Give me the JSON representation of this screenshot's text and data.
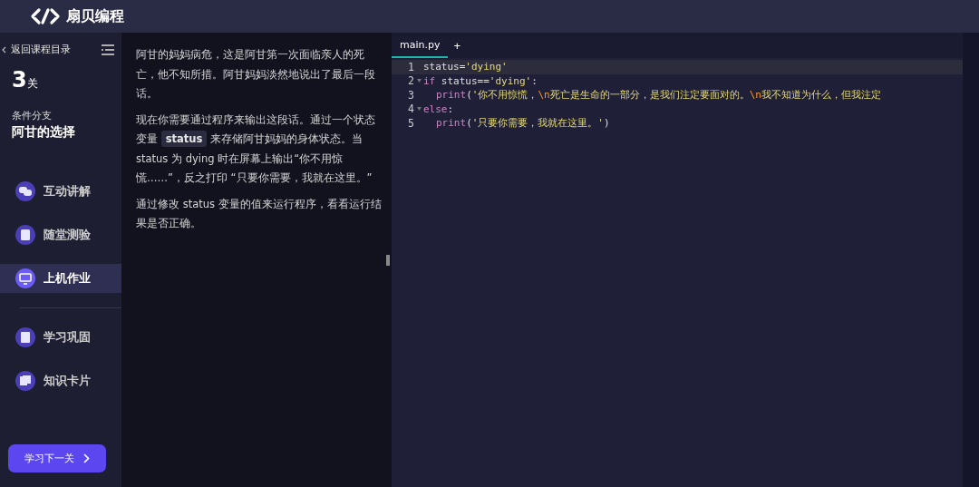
{
  "header": {
    "brand": "扇贝编程"
  },
  "sidebar": {
    "back": "返回课程目录",
    "level_number": "3",
    "level_unit": "关",
    "chapter": "条件分支",
    "lesson": "阿甘的选择",
    "items": [
      {
        "label": "互动讲解",
        "selected": false,
        "kind": "chat"
      },
      {
        "label": "随堂测验",
        "selected": false,
        "kind": "quiz"
      },
      {
        "label": "上机作业",
        "selected": true,
        "kind": "computer"
      },
      {
        "label": "学习巩固",
        "selected": false,
        "kind": "book"
      },
      {
        "label": "知识卡片",
        "selected": false,
        "kind": "cards"
      }
    ],
    "next_button": "学习下一关"
  },
  "description": [
    [
      {
        "kind": "text",
        "text": "阿甘的妈妈病危，这是阿甘第一次面临亲人的死亡，他不知所措。阿甘妈妈淡然地说出了最后一段话。"
      }
    ],
    [
      {
        "kind": "text",
        "text": "现在你需要通过程序来输出这段话。通过一个状态变量 "
      },
      {
        "kind": "code",
        "text": "status"
      },
      {
        "kind": "text",
        "text": " 来存储阿甘妈妈的身体状态。当 status 为 dying 时在屏幕上输出“你不用惊慌……”，反之打印 “只要你需要，我就在这里。”"
      }
    ],
    [
      {
        "kind": "text",
        "text": "通过修改 status 变量的值来运行程序，看看运行结果是否正确。"
      }
    ]
  ],
  "editor": {
    "tabs": [
      {
        "label": "main.py",
        "selected": true
      }
    ],
    "add_tab": "+",
    "lines": [
      {
        "number": "1",
        "active": true,
        "foldable": false,
        "tokens": [
          {
            "kind": "plain",
            "text": "status="
          },
          {
            "kind": "string",
            "text": "'dying'"
          }
        ]
      },
      {
        "number": "2",
        "active": false,
        "foldable": true,
        "tokens": [
          {
            "kind": "keyword",
            "text": "if"
          },
          {
            "kind": "plain",
            "text": " status=="
          },
          {
            "kind": "string",
            "text": "'dying'"
          },
          {
            "kind": "plain",
            "text": ":"
          }
        ],
        "children": [
          {
            "number": "3",
            "active": false,
            "foldable": false,
            "tokens": [
              {
                "kind": "function",
                "text": "print"
              },
              {
                "kind": "plain",
                "text": "("
              },
              {
                "kind": "string",
                "text": "'你不用惊慌，"
              },
              {
                "kind": "escape",
                "text": "\\n"
              },
              {
                "kind": "string",
                "text": "死亡是生命的一部分，是我们注定要面对的。"
              },
              {
                "kind": "escape",
                "text": "\\n"
              },
              {
                "kind": "string",
                "text": "我不知道为什么，但我注定"
              }
            ]
          }
        ]
      },
      {
        "number": "4",
        "active": false,
        "foldable": true,
        "tokens": [
          {
            "kind": "keyword",
            "text": "else"
          },
          {
            "kind": "plain",
            "text": ":"
          }
        ],
        "children": [
          {
            "number": "5",
            "active": false,
            "foldable": false,
            "tokens": [
              {
                "kind": "function",
                "text": "print"
              },
              {
                "kind": "plain",
                "text": "("
              },
              {
                "kind": "string",
                "text": "'只要你需要，我就在这里。'"
              },
              {
                "kind": "plain",
                "text": ")"
              }
            ]
          }
        ]
      }
    ]
  }
}
